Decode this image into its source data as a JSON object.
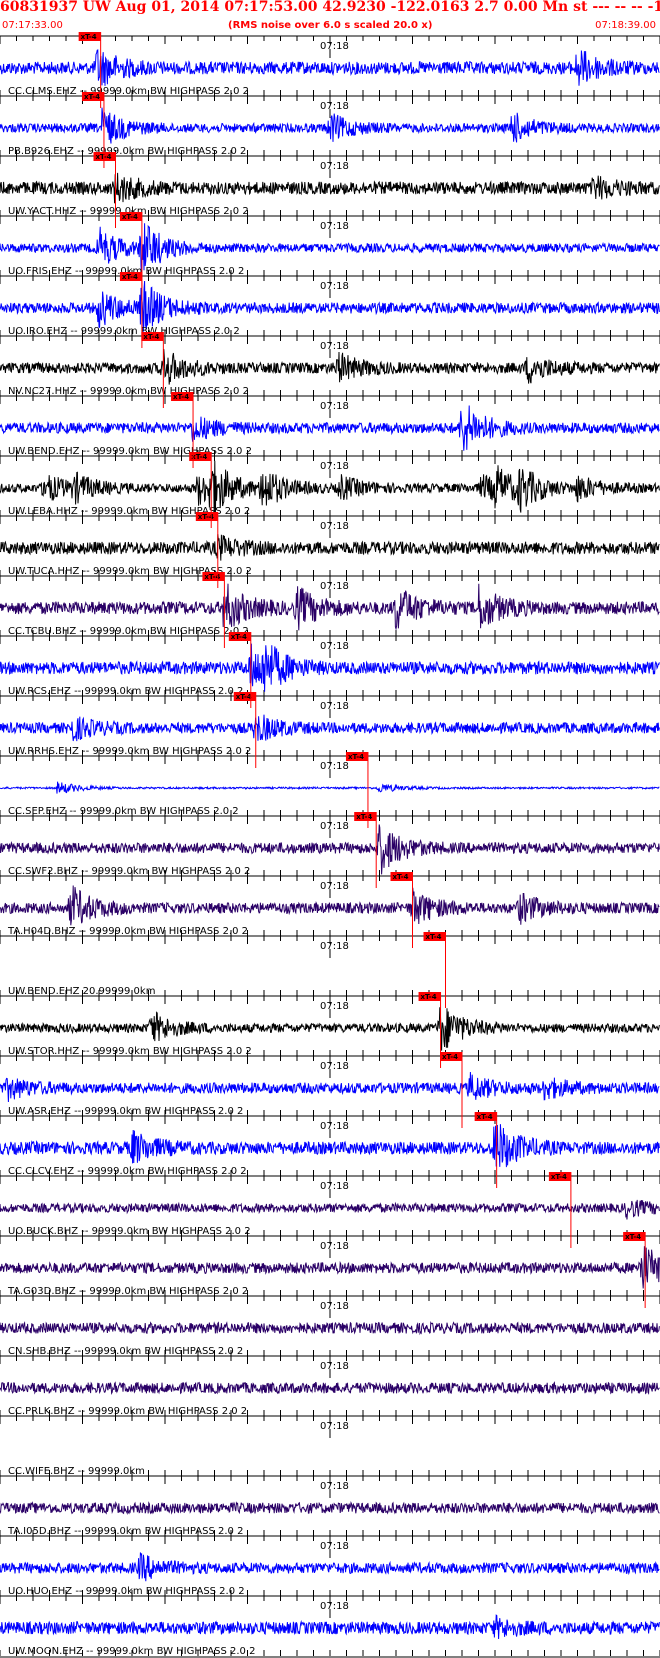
{
  "header": {
    "title": "60831937 UW Aug 01, 2014 07:17:53.00   42.9230 -122.0163  2.7 0.00 Mn st --- -- --  -1",
    "start_time": "07:17:33.00",
    "end_time": "07:18:39.00",
    "rms_note": "(RMS noise over 6.0 s scaled 20.0 x)"
  },
  "chart_data": {
    "type": "line",
    "title": "60831937 UW Aug 01, 2014 07:17:53.00   42.9230 -122.0163  2.7 0.00 Mn st --- -- --  -1",
    "xlabel": "",
    "ylabel": "",
    "x_range": [
      "07:17:33.00",
      "07:18:39.00"
    ],
    "x_tick_label": "07:18",
    "pick_label": "xT-4",
    "colors": {
      "blue": "#0000ff",
      "black": "#000000",
      "purple": "#2a0066",
      "pick": "#ff0000"
    },
    "series": [
      {
        "name": "CC.CLMS.EHZ -- 99999.0km BW  HIGHPASS  2.0  2",
        "color": "blue",
        "amplitude": 0.35,
        "pick_time": 6.1,
        "events": [
          [
            5.9,
            1.0
          ],
          [
            35.0,
            0.9
          ],
          [
            56.0,
            0.7
          ]
        ]
      },
      {
        "name": "PB.B926.EHZ -- 99999.0km BW  HIGHPASS  2.0  2",
        "color": "blue",
        "amplitude": 0.25,
        "pick_time": 6.3,
        "events": [
          [
            6.2,
            1.0
          ],
          [
            20.0,
            0.7
          ],
          [
            31.0,
            0.8
          ],
          [
            55.0,
            0.6
          ]
        ]
      },
      {
        "name": "UW.YACT.HHZ -- 99999.0km BW  HIGHPASS  2.0  2",
        "color": "black",
        "amplitude": 0.35,
        "pick_time": 7.0,
        "events": [
          [
            7.0,
            0.7
          ],
          [
            36.0,
            0.5
          ]
        ]
      },
      {
        "name": "UO.FRIS.EHZ -- 99999.0km BW  HIGHPASS  2.0  2",
        "color": "blue",
        "amplitude": 0.25,
        "pick_time": 8.6,
        "events": [
          [
            6.0,
            1.0
          ],
          [
            8.6,
            1.4
          ],
          [
            51.0,
            0.8
          ]
        ]
      },
      {
        "name": "UO.IRO.EHZ -- 99999.0km BW  HIGHPASS  2.0  2",
        "color": "blue",
        "amplitude": 0.3,
        "pick_time": 8.6,
        "events": [
          [
            6.0,
            0.9
          ],
          [
            8.6,
            1.3
          ]
        ]
      },
      {
        "name": "NV.NC27.HHZ -- 99999.0km BW  HIGHPASS  2.0  2",
        "color": "black",
        "amplitude": 0.3,
        "pick_time": 9.9,
        "events": [
          [
            9.9,
            0.9
          ],
          [
            20.5,
            0.7
          ],
          [
            32.0,
            0.7
          ]
        ]
      },
      {
        "name": "UW.BEND.EHZ -- 99999.0km BW  HIGHPASS  2.0  2",
        "color": "blue",
        "amplitude": 0.3,
        "pick_time": 11.7,
        "events": [
          [
            11.7,
            0.6
          ],
          [
            28.0,
            1.4
          ]
        ]
      },
      {
        "name": "UW.LEBA.HHZ -- 99999.0km BW  HIGHPASS  2.0  2",
        "color": "black",
        "amplitude": 0.25,
        "pick_time": 12.8,
        "events": [
          [
            2.7,
            0.7
          ],
          [
            4.5,
            0.6
          ],
          [
            12.0,
            0.8
          ],
          [
            12.8,
            1.2
          ],
          [
            15.9,
            1.1
          ],
          [
            20.6,
            0.6
          ],
          [
            29.2,
            0.6
          ],
          [
            30.0,
            0.9
          ],
          [
            31.5,
            0.9
          ],
          [
            35.0,
            0.6
          ]
        ]
      },
      {
        "name": "UW.TUCA.HHZ -- 99999.0km BW  HIGHPASS  2.0  2",
        "color": "black",
        "amplitude": 0.35,
        "pick_time": 13.2,
        "events": [
          [
            13.2,
            0.5
          ]
        ]
      },
      {
        "name": "CC.TCBU.BHZ -- 99999.0km BW  HIGHPASS  2.0  2",
        "color": "purple",
        "amplitude": 0.35,
        "pick_time": 13.6,
        "events": [
          [
            13.6,
            1.2
          ],
          [
            18.0,
            1.0
          ],
          [
            24.0,
            1.1
          ],
          [
            29.0,
            1.1
          ]
        ]
      },
      {
        "name": "UW.RCS.EHZ -- 99999.0km BW  HIGHPASS  2.0  2",
        "color": "blue",
        "amplitude": 0.35,
        "pick_time": 15.2,
        "events": [
          [
            15.2,
            1.1
          ],
          [
            16.0,
            0.9
          ]
        ]
      },
      {
        "name": "UW.RRHS.EHZ -- 99999.0km BW  HIGHPASS  2.0  2",
        "color": "blue",
        "amplitude": 0.3,
        "pick_time": 15.5,
        "events": [
          [
            4.3,
            0.6
          ],
          [
            15.5,
            0.7
          ]
        ]
      },
      {
        "name": "CC.SEP.EHZ -- 99999.0km BW  HIGHPASS  2.0  2",
        "color": "blue",
        "amplitude": 0.05,
        "pick_time": 22.3,
        "events": [
          [
            3.5,
            0.35
          ],
          [
            23.0,
            0.25
          ]
        ]
      },
      {
        "name": "CC.SWF2.BHZ -- 99999.0km BW  HIGHPASS  2.0  2",
        "color": "purple",
        "amplitude": 0.3,
        "pick_time": 22.8,
        "events": [
          [
            23.0,
            1.3
          ]
        ]
      },
      {
        "name": "TA.H04D.BHZ -- 99999.0km BW  HIGHPASS  2.0  2",
        "color": "purple",
        "amplitude": 0.3,
        "pick_time": 25.0,
        "events": [
          [
            4.3,
            1.1
          ],
          [
            25.0,
            0.9
          ],
          [
            31.5,
            0.7
          ]
        ]
      },
      {
        "name": "UW.BEND.EHZ 20.99999.0km",
        "color": "none",
        "amplitude": 0,
        "pick_time": 27.0,
        "events": []
      },
      {
        "name": "UW.STOR.HHZ -- 99999.0km BW  HIGHPASS  2.0  2",
        "color": "black",
        "amplitude": 0.25,
        "pick_time": 26.7,
        "events": [
          [
            9.2,
            0.8
          ],
          [
            26.7,
            1.3
          ]
        ]
      },
      {
        "name": "UW.ASR.EHZ -- 99999.0km BW  HIGHPASS  2.0  2",
        "color": "blue",
        "amplitude": 0.3,
        "pick_time": 28.0,
        "events": [
          [
            0.5,
            0.5
          ],
          [
            28.5,
            0.6
          ],
          [
            33.0,
            0.5
          ]
        ]
      },
      {
        "name": "CC.CLCV.EHZ -- 99999.0km BW  HIGHPASS  2.0  2",
        "color": "blue",
        "amplitude": 0.35,
        "pick_time": 30.1,
        "events": [
          [
            8.0,
            0.8
          ],
          [
            30.0,
            1.4
          ]
        ]
      },
      {
        "name": "UO.BUCK.BHZ -- 99999.0km BW  HIGHPASS  2.0  2",
        "color": "purple",
        "amplitude": 0.25,
        "pick_time": 34.6,
        "events": [
          [
            38.0,
            0.4
          ]
        ]
      },
      {
        "name": "TA.G03D.BHZ -- 99999.0km BW  HIGHPASS  2.0  2",
        "color": "purple",
        "amplitude": 0.3,
        "pick_time": 39.1,
        "events": [
          [
            38.9,
            1.2
          ]
        ]
      },
      {
        "name": "CN.SHB.BHZ -- 99999.0km BW  HIGHPASS  2.0  2",
        "color": "purple",
        "amplitude": 0.3,
        "pick_time": null,
        "events": []
      },
      {
        "name": "CC.PRLK.BHZ -- 99999.0km BW  HIGHPASS  2.0  2",
        "color": "purple",
        "amplitude": 0.3,
        "pick_time": null,
        "events": []
      },
      {
        "name": "CC.WIFE.BHZ -- 99999.0km",
        "color": "none",
        "amplitude": 0,
        "pick_time": null,
        "events": []
      },
      {
        "name": "TA.I05D.BHZ -- 99999.0km BW  HIGHPASS  2.0  2",
        "color": "purple",
        "amplitude": 0.3,
        "pick_time": null,
        "events": []
      },
      {
        "name": "UO.HUO.EHZ -- 99999.0km BW  HIGHPASS  2.0  2",
        "color": "blue",
        "amplitude": 0.3,
        "pick_time": null,
        "events": [
          [
            8.5,
            0.6
          ]
        ]
      },
      {
        "name": "UW.MOON.EHZ -- 99999.0km BW  HIGHPASS  2.0  2",
        "color": "blue",
        "amplitude": 0.35,
        "pick_time": null,
        "events": [
          [
            30.0,
            0.4
          ]
        ]
      }
    ]
  }
}
